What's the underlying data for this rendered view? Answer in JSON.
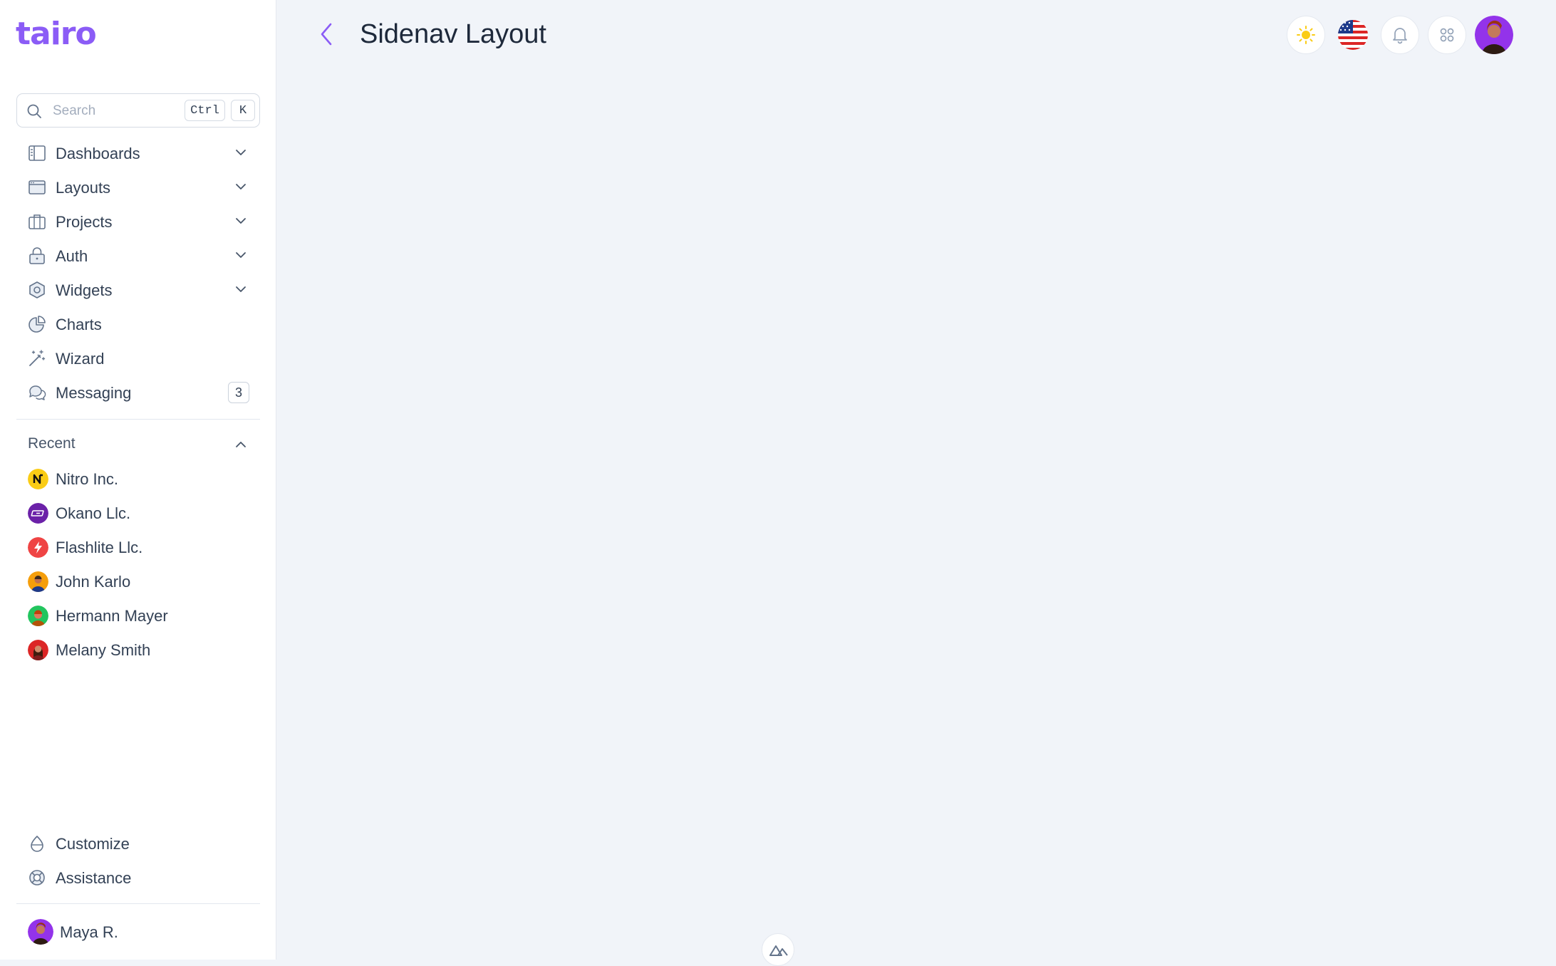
{
  "brand": {
    "logo_text": "tairo",
    "accent_color": "#8b5cf6"
  },
  "search": {
    "placeholder": "Search",
    "shortcut_keys": [
      "Ctrl",
      "K"
    ]
  },
  "nav": {
    "items": [
      {
        "label": "Dashboards",
        "icon": "dashboard-icon",
        "expandable": true
      },
      {
        "label": "Layouts",
        "icon": "layout-icon",
        "expandable": true
      },
      {
        "label": "Projects",
        "icon": "briefcase-icon",
        "expandable": true
      },
      {
        "label": "Auth",
        "icon": "lock-icon",
        "expandable": true
      },
      {
        "label": "Widgets",
        "icon": "hexagon-icon",
        "expandable": true
      },
      {
        "label": "Charts",
        "icon": "pie-chart-icon",
        "expandable": false
      },
      {
        "label": "Wizard",
        "icon": "magic-wand-icon",
        "expandable": false
      },
      {
        "label": "Messaging",
        "icon": "chat-icon",
        "expandable": false,
        "badge": "3"
      }
    ]
  },
  "recent": {
    "header": "Recent",
    "items": [
      {
        "label": "Nitro Inc.",
        "avatar_color": "#facc15"
      },
      {
        "label": "Okano Llc.",
        "avatar_color": "#6b21a8"
      },
      {
        "label": "Flashlite Llc.",
        "avatar_color": "#ef4444"
      },
      {
        "label": "John Karlo",
        "avatar_color": "#f59e0b"
      },
      {
        "label": "Hermann Mayer",
        "avatar_color": "#22c55e"
      },
      {
        "label": "Melany Smith",
        "avatar_color": "#dc2626"
      }
    ]
  },
  "footer": {
    "items": [
      {
        "label": "Customize",
        "icon": "drop-icon"
      },
      {
        "label": "Assistance",
        "icon": "lifebuoy-icon"
      }
    ],
    "user": {
      "name": "Maya R."
    }
  },
  "header": {
    "title": "Sidenav Layout",
    "actions": [
      "sun-icon",
      "us-flag-icon",
      "bell-icon",
      "apps-grid-icon",
      "user-avatar"
    ]
  }
}
